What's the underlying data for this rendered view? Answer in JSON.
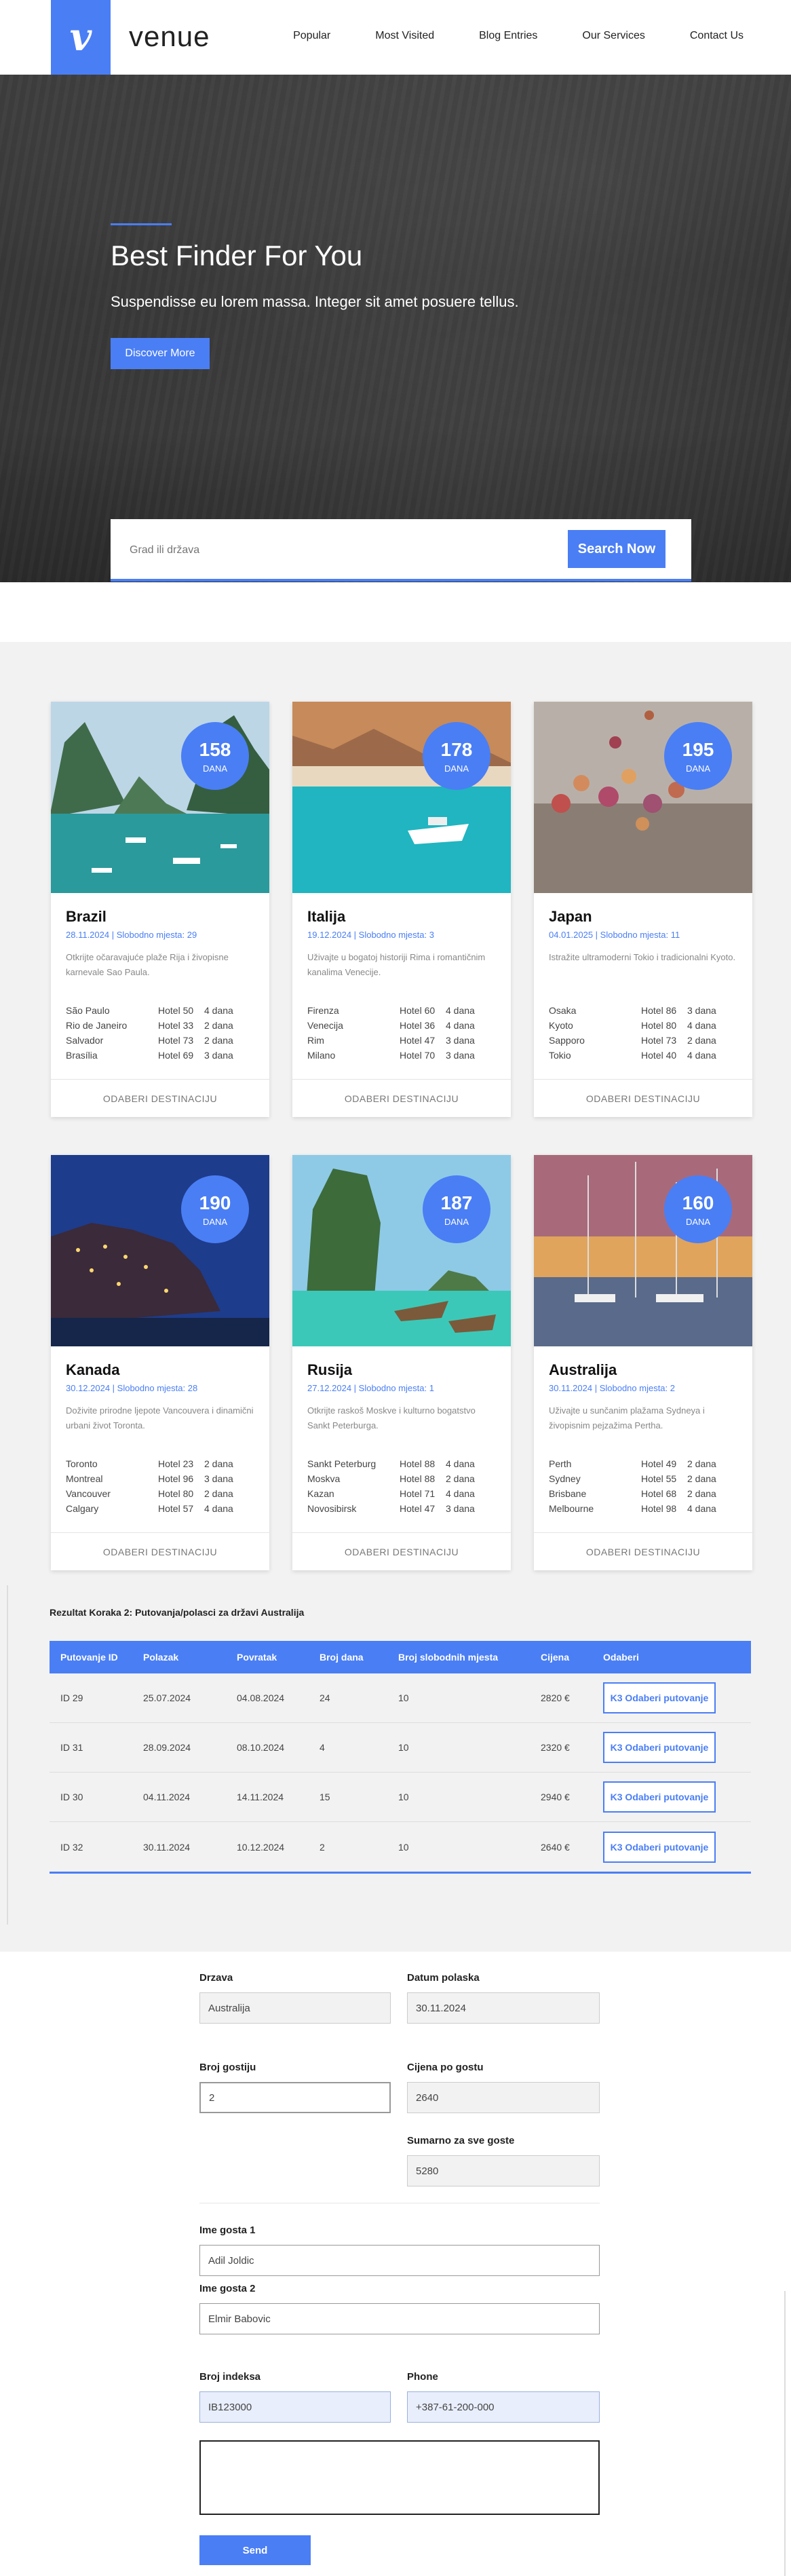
{
  "header": {
    "brand": "venue",
    "nav": [
      "Popular",
      "Most Visited",
      "Blog Entries",
      "Our Services",
      "Contact Us"
    ]
  },
  "hero": {
    "title": "Best Finder For You",
    "subtitle": "Suspendisse eu lorem massa. Integer sit amet posuere tellus.",
    "cta": "Discover More",
    "search_placeholder": "Grad ili država",
    "search_button": "Search Now"
  },
  "cards": [
    {
      "days": "158",
      "days_label": "DANA",
      "title": "Brazil",
      "meta": "28.11.2024 | Slobodno mjesta: 29",
      "desc": "Otkrijte očaravajuće plaže Rija i živopisne karnevale Sao Paula.",
      "rows": [
        [
          "São Paulo",
          "Hotel 50",
          "4 dana"
        ],
        [
          "Rio de Janeiro",
          "Hotel 33",
          "2 dana"
        ],
        [
          "Salvador",
          "Hotel 73",
          "2 dana"
        ],
        [
          "Brasília",
          "Hotel 69",
          "3 dana"
        ]
      ],
      "button": "ODABERI DESTINACIJU"
    },
    {
      "days": "178",
      "days_label": "DANA",
      "title": "Italija",
      "meta": "19.12.2024 | Slobodno mjesta: 3",
      "desc": "Uživajte u bogatoj historiji Rima i romantičnim kanalima Venecije.",
      "rows": [
        [
          "Firenza",
          "Hotel 60",
          "4 dana"
        ],
        [
          "Venecija",
          "Hotel 36",
          "4 dana"
        ],
        [
          "Rim",
          "Hotel 47",
          "3 dana"
        ],
        [
          "Milano",
          "Hotel 70",
          "3 dana"
        ]
      ],
      "button": "ODABERI DESTINACIJU"
    },
    {
      "days": "195",
      "days_label": "DANA",
      "title": "Japan",
      "meta": "04.01.2025 | Slobodno mjesta: 11",
      "desc": "Istražite ultramoderni Tokio i tradicionalni Kyoto.",
      "rows": [
        [
          "Osaka",
          "Hotel 86",
          "3 dana"
        ],
        [
          "Kyoto",
          "Hotel 80",
          "4 dana"
        ],
        [
          "Sapporo",
          "Hotel 73",
          "2 dana"
        ],
        [
          "Tokio",
          "Hotel 40",
          "4 dana"
        ]
      ],
      "button": "ODABERI DESTINACIJU"
    },
    {
      "days": "190",
      "days_label": "DANA",
      "title": "Kanada",
      "meta": "30.12.2024 | Slobodno mjesta: 28",
      "desc": "Doživite prirodne ljepote Vancouvera i dinamični urbani život Toronta.",
      "rows": [
        [
          "Toronto",
          "Hotel 23",
          "2 dana"
        ],
        [
          "Montreal",
          "Hotel 96",
          "3 dana"
        ],
        [
          "Vancouver",
          "Hotel 80",
          "2 dana"
        ],
        [
          "Calgary",
          "Hotel 57",
          "4 dana"
        ]
      ],
      "button": "ODABERI DESTINACIJU"
    },
    {
      "days": "187",
      "days_label": "DANA",
      "title": "Rusija",
      "meta": "27.12.2024 | Slobodno mjesta: 1",
      "desc": "Otkrijte raskoš Moskve i kulturno bogatstvo Sankt Peterburga.",
      "rows": [
        [
          "Sankt Peterburg",
          "Hotel 88",
          "4 dana"
        ],
        [
          "Moskva",
          "Hotel 88",
          "2 dana"
        ],
        [
          "Kazan",
          "Hotel 71",
          "4 dana"
        ],
        [
          "Novosibirsk",
          "Hotel 47",
          "3 dana"
        ]
      ],
      "button": "ODABERI DESTINACIJU"
    },
    {
      "days": "160",
      "days_label": "DANA",
      "title": "Australija",
      "meta": "30.11.2024 | Slobodno mjesta: 2",
      "desc": "Uživajte u sunčanim plažama Sydneya i živopisnim pejzažima Pertha.",
      "rows": [
        [
          "Perth",
          "Hotel 49",
          "2 dana"
        ],
        [
          "Sydney",
          "Hotel 55",
          "2 dana"
        ],
        [
          "Brisbane",
          "Hotel 68",
          "2 dana"
        ],
        [
          "Melbourne",
          "Hotel 98",
          "4 dana"
        ]
      ],
      "button": "ODABERI DESTINACIJU"
    }
  ],
  "results": {
    "title": "Rezultat Koraka 2: Putovanja/polasci za državi Australija",
    "headers": [
      "Putovanje ID",
      "Polazak",
      "Povratak",
      "Broj dana",
      "Broj slobodnih mjesta",
      "Cijena",
      "Odaberi"
    ],
    "rows": [
      {
        "id": "ID 29",
        "polazak": "25.07.2024",
        "povratak": "04.08.2024",
        "dana": "24",
        "mjesta": "10",
        "cijena": "2820 €",
        "btn": "K3 Odaberi putovanje"
      },
      {
        "id": "ID 31",
        "polazak": "28.09.2024",
        "povratak": "08.10.2024",
        "dana": "4",
        "mjesta": "10",
        "cijena": "2320 €",
        "btn": "K3 Odaberi putovanje"
      },
      {
        "id": "ID 30",
        "polazak": "04.11.2024",
        "povratak": "14.11.2024",
        "dana": "15",
        "mjesta": "10",
        "cijena": "2940 €",
        "btn": "K3 Odaberi putovanje"
      },
      {
        "id": "ID 32",
        "polazak": "30.11.2024",
        "povratak": "10.12.2024",
        "dana": "2",
        "mjesta": "10",
        "cijena": "2640 €",
        "btn": "K3 Odaberi putovanje"
      }
    ]
  },
  "form": {
    "drzava_label": "Drzava",
    "drzava_value": "Australija",
    "datum_label": "Datum polaska",
    "datum_value": "30.11.2024",
    "gosti_label": "Broj gostiju",
    "gosti_value": "2",
    "cijena_label": "Cijena po gostu",
    "cijena_value": "2640",
    "sumarno_label": "Sumarno za sve goste",
    "sumarno_value": "5280",
    "gost1_label": "Ime gosta 1",
    "gost1_value": "Adil Joldic",
    "gost2_label": "Ime gosta 2",
    "gost2_value": "Elmir Babovic",
    "indeks_label": "Broj indeksa",
    "indeks_value": "IB123000",
    "phone_label": "Phone",
    "phone_value": "+387-61-200-000",
    "send_label": "Send"
  }
}
